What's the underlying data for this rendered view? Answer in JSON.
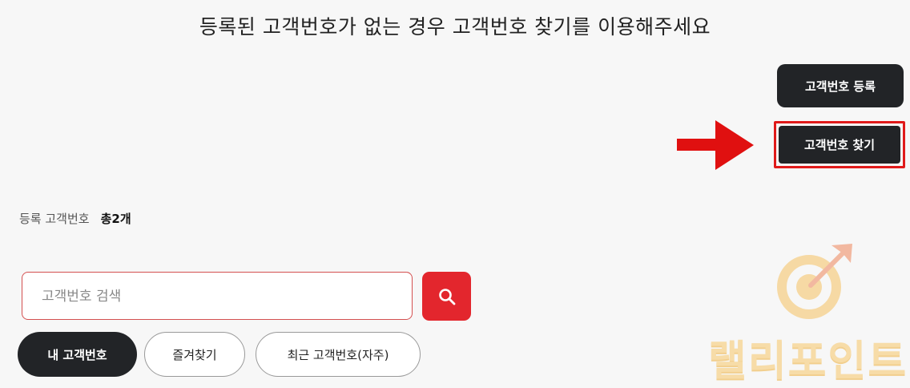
{
  "heading": "등록된 고객번호가 없는 경우 고객번호 찾기를 이용해주세요",
  "buttons": {
    "register": "고객번호 등록",
    "find": "고객번호 찾기"
  },
  "count": {
    "label": "등록 고객번호",
    "value": "총2개"
  },
  "search": {
    "placeholder": "고객번호 검색",
    "value": ""
  },
  "tabs": [
    {
      "label": "내 고객번호",
      "active": true
    },
    {
      "label": "즐겨찾기",
      "active": false
    },
    {
      "label": "최근 고객번호(자주)",
      "active": false
    }
  ],
  "watermark": "랠리포인트",
  "colors": {
    "accent_red": "#e3262d",
    "dark_button": "#222427",
    "highlight_border": "#e01a1a"
  },
  "icons": [
    "arrow-right-icon",
    "search-icon",
    "target-logo-icon"
  ]
}
